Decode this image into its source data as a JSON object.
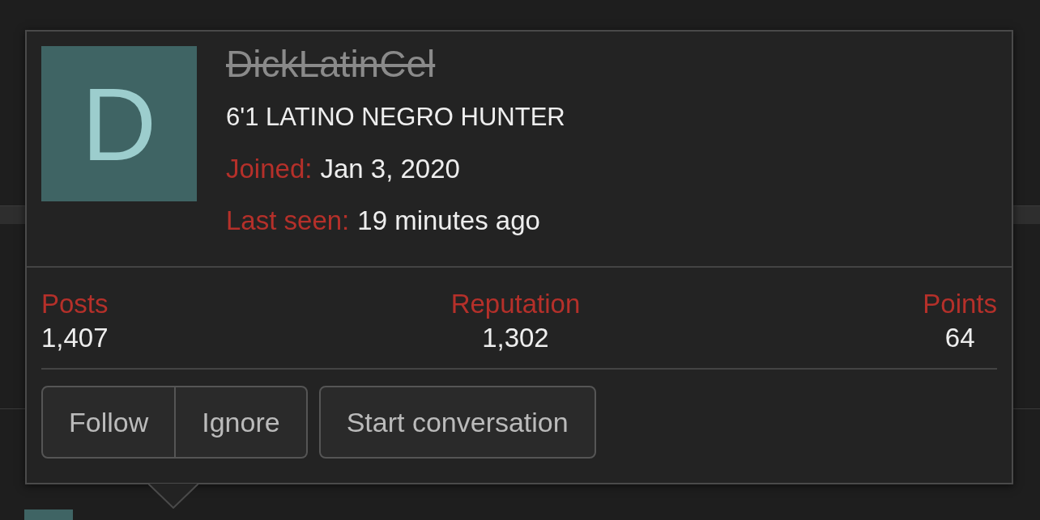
{
  "profile": {
    "avatar_letter": "D",
    "username": "DickLatinCel",
    "username_struck": true,
    "user_title": "6'1 LATINO NEGRO HUNTER",
    "facts": [
      {
        "label": "Joined:",
        "value": "Jan 3, 2020"
      },
      {
        "label": "Last seen:",
        "value": "19 minutes ago"
      }
    ]
  },
  "stats": [
    {
      "label": "Posts",
      "value": "1,407"
    },
    {
      "label": "Reputation",
      "value": "1,302"
    },
    {
      "label": "Points",
      "value": "64"
    }
  ],
  "button_groups": [
    [
      "Follow",
      "Ignore"
    ],
    [
      "Start conversation"
    ]
  ]
}
